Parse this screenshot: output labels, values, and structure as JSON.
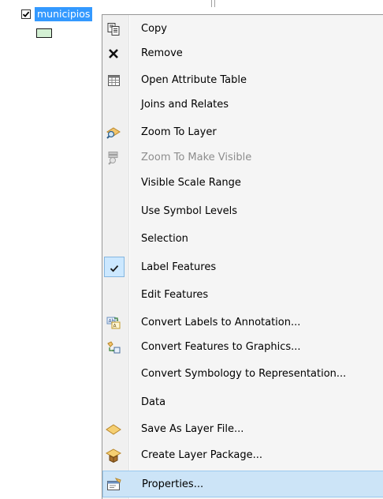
{
  "toc": {
    "layer_name": "municipios",
    "layer_checked": true,
    "symbol_fill": "#d4f0d4"
  },
  "menu": {
    "items": [
      {
        "label": "Copy",
        "icon": "copy-icon",
        "enabled": true
      },
      {
        "label": "Remove",
        "icon": "remove-icon",
        "enabled": true
      },
      {
        "label": "Open Attribute Table",
        "icon": "table-icon",
        "enabled": true
      },
      {
        "label": "Joins and Relates",
        "icon": "",
        "enabled": true
      },
      {
        "label": "Zoom To Layer",
        "icon": "zoom-to-layer-icon",
        "enabled": true
      },
      {
        "label": "Zoom To Make Visible",
        "icon": "zoom-to-make-visible-icon",
        "enabled": false
      },
      {
        "label": "Visible Scale Range",
        "icon": "",
        "enabled": true
      },
      {
        "label": "Use Symbol Levels",
        "icon": "",
        "enabled": true
      },
      {
        "label": "Selection",
        "icon": "",
        "enabled": true
      },
      {
        "label": "Label Features",
        "icon": "checkmark-icon",
        "enabled": true,
        "checked": true
      },
      {
        "label": "Edit Features",
        "icon": "",
        "enabled": true
      },
      {
        "label": "Convert Labels to Annotation...",
        "icon": "labels-to-annotation-icon",
        "enabled": true
      },
      {
        "label": "Convert Features to Graphics...",
        "icon": "features-to-graphics-icon",
        "enabled": true
      },
      {
        "label": "Convert Symbology to Representation...",
        "icon": "",
        "enabled": true
      },
      {
        "label": "Data",
        "icon": "",
        "enabled": true
      },
      {
        "label": "Save As Layer File...",
        "icon": "layer-file-icon",
        "enabled": true
      },
      {
        "label": "Create Layer Package...",
        "icon": "layer-package-icon",
        "enabled": true
      },
      {
        "label": "Properties...",
        "icon": "properties-icon",
        "enabled": true,
        "highlighted": true
      }
    ]
  },
  "colors": {
    "selection_blue": "#3399ff",
    "menu_highlight": "#cce4f7"
  }
}
